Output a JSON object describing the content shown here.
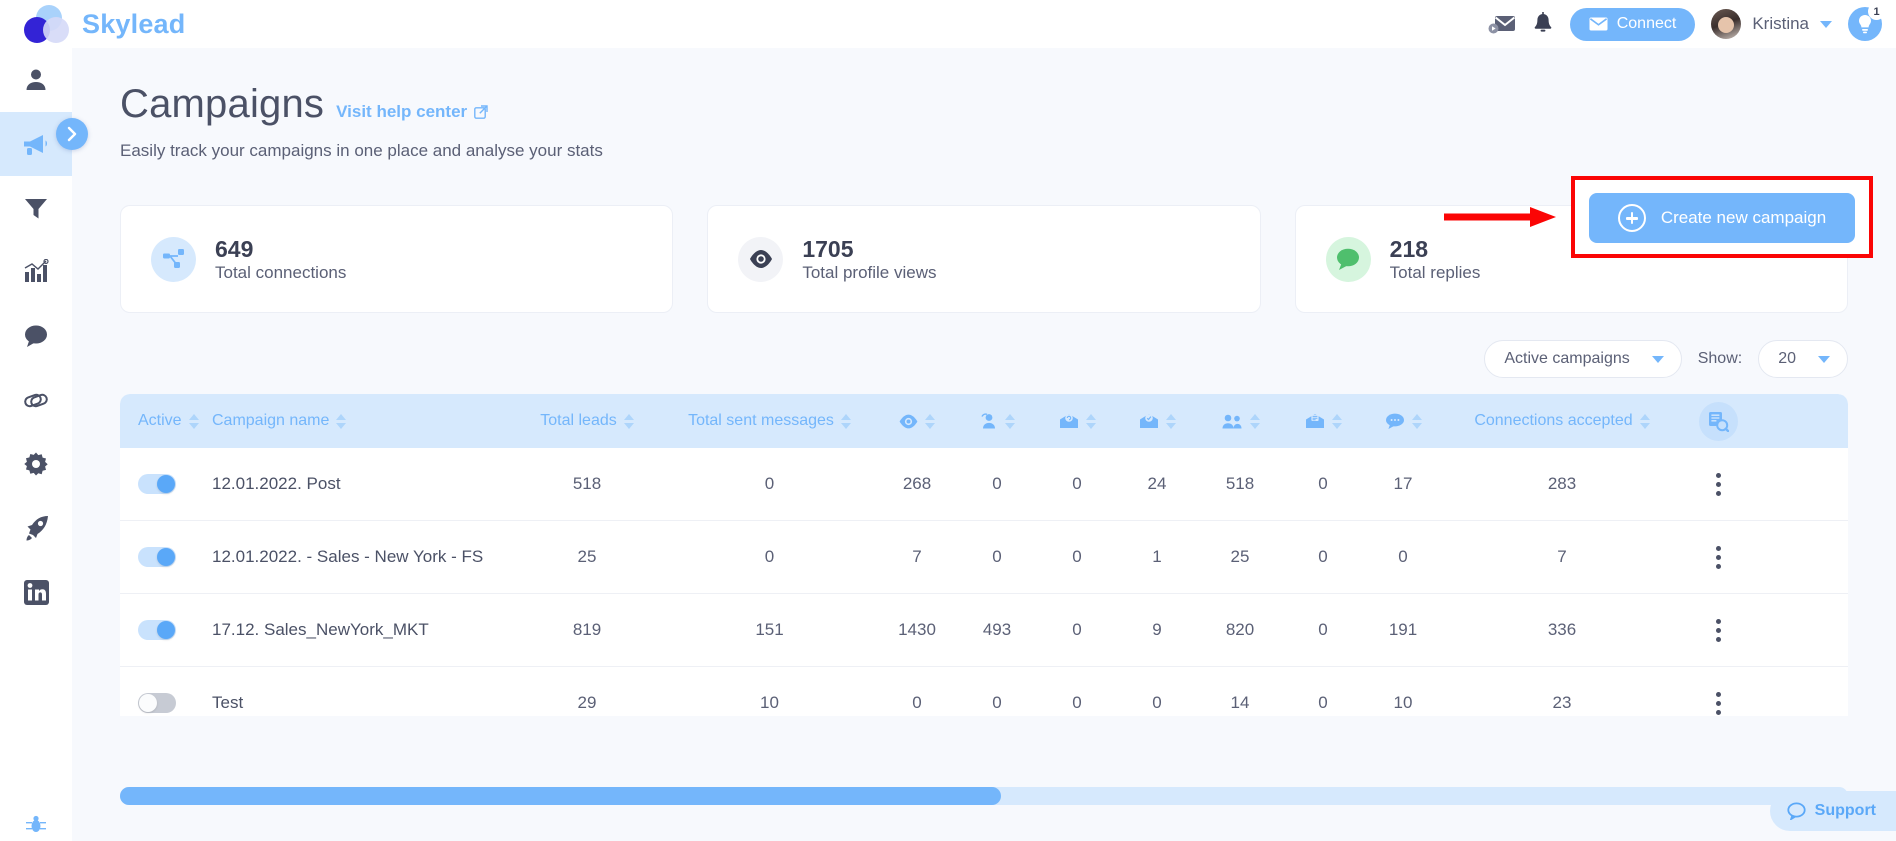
{
  "brand": {
    "name": "Skylead"
  },
  "topbar": {
    "mail_icon": "mail-video-icon",
    "bell_icon": "bell-icon",
    "connect_label": "Connect",
    "user_name": "Kristina",
    "tips_badge": "1"
  },
  "sidebar": {
    "items": [
      {
        "name": "sidebar-item-profile",
        "icon": "person-icon",
        "active": false
      },
      {
        "name": "sidebar-item-campaigns",
        "icon": "megaphone-icon",
        "active": true
      },
      {
        "name": "sidebar-item-filters",
        "icon": "funnel-icon",
        "active": false
      },
      {
        "name": "sidebar-item-reports",
        "icon": "bar-chart-icon",
        "active": false
      },
      {
        "name": "sidebar-item-inbox",
        "icon": "chat-icon",
        "active": false
      },
      {
        "name": "sidebar-item-links",
        "icon": "link-icon",
        "active": false
      },
      {
        "name": "sidebar-item-settings",
        "icon": "gear-icon",
        "active": false
      },
      {
        "name": "sidebar-item-upgrade",
        "icon": "rocket-icon",
        "active": false
      },
      {
        "name": "sidebar-item-linkedin",
        "icon": "linkedin-icon",
        "active": false
      }
    ],
    "expand_icon": "chevron-right-icon",
    "bottom_icon": "bug-icon"
  },
  "header": {
    "title": "Campaigns",
    "help_link": "Visit help center",
    "help_icon": "external-link-icon",
    "subtitle": "Easily track your campaigns in one place and analyse your stats"
  },
  "cta": {
    "label": "Create new campaign",
    "icon": "plus-circle-icon",
    "highlight_color": "#fb0505",
    "button_color": "#74b6fb"
  },
  "stats": [
    {
      "value": "649",
      "label": "Total connections",
      "icon": "network-icon",
      "icon_bg": "#d6e9fd"
    },
    {
      "value": "1705",
      "label": "Total profile views",
      "icon": "eye-icon",
      "icon_bg": "#f2f3f7"
    },
    {
      "value": "218",
      "label": "Total replies",
      "icon": "chat-bubble-icon",
      "icon_bg": "#d6f5de"
    }
  ],
  "controls": {
    "filter_value": "Active campaigns",
    "show_label": "Show:",
    "show_value": "20"
  },
  "table": {
    "columns": [
      {
        "label": "Active",
        "icon": "",
        "sortable": true
      },
      {
        "label": "Campaign name",
        "icon": "",
        "sortable": true
      },
      {
        "label": "Total leads",
        "icon": "",
        "sortable": true
      },
      {
        "label": "Total sent messages",
        "icon": "",
        "sortable": true
      },
      {
        "label": "",
        "icon": "eye-icon",
        "sortable": true
      },
      {
        "label": "",
        "icon": "follow-profile-icon",
        "sortable": true
      },
      {
        "label": "",
        "icon": "inmail-sent-icon",
        "sortable": true
      },
      {
        "label": "",
        "icon": "inmail-opened-icon",
        "sortable": true
      },
      {
        "label": "",
        "icon": "connections-icon",
        "sortable": true
      },
      {
        "label": "",
        "icon": "email-reply-icon",
        "sortable": true
      },
      {
        "label": "",
        "icon": "message-icon",
        "sortable": true
      },
      {
        "label": "Connections accepted",
        "icon": "",
        "sortable": true
      }
    ],
    "tool_icon": "table-search-icon",
    "row_menu_icon": "kebab-menu-icon",
    "rows": [
      {
        "active": true,
        "name": "12.01.2022. Post",
        "cells": [
          "518",
          "0",
          "268",
          "0",
          "0",
          "24",
          "518",
          "0",
          "17",
          "283"
        ]
      },
      {
        "active": true,
        "name": "12.01.2022. - Sales - New York - FS",
        "cells": [
          "25",
          "0",
          "7",
          "0",
          "0",
          "1",
          "25",
          "0",
          "0",
          "7"
        ]
      },
      {
        "active": true,
        "name": "17.12. Sales_NewYork_MKT",
        "cells": [
          "819",
          "151",
          "1430",
          "493",
          "0",
          "9",
          "820",
          "0",
          "191",
          "336"
        ]
      },
      {
        "active": false,
        "name": "Test",
        "cells": [
          "29",
          "10",
          "0",
          "0",
          "0",
          "0",
          "14",
          "0",
          "10",
          "23"
        ]
      }
    ],
    "scroll_position_percent": "51"
  },
  "support": {
    "label": "Support",
    "icon": "chat-outline-icon"
  }
}
